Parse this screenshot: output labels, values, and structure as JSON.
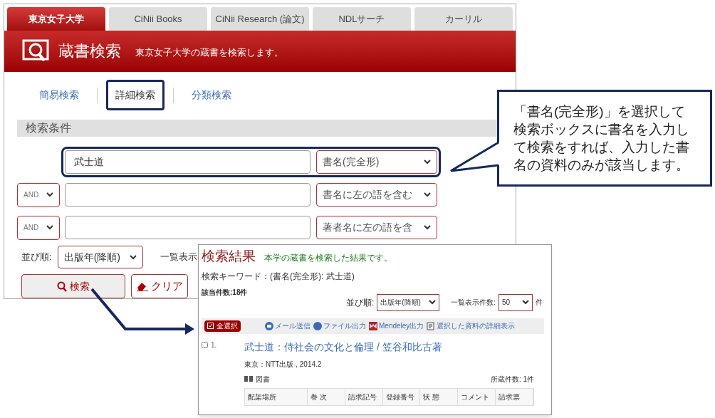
{
  "tabs": [
    {
      "label": "東京女子大学",
      "selected": true
    },
    {
      "label": "CiNii Books",
      "selected": false
    },
    {
      "label": "CiNii Research (論文)",
      "selected": false
    },
    {
      "label": "NDLサーチ",
      "selected": false
    },
    {
      "label": "カーリル",
      "selected": false
    }
  ],
  "header": {
    "title": "蔵書検索",
    "subtitle": "東京女子大学の蔵書を検索します。"
  },
  "search_modes": [
    {
      "label": "簡易検索",
      "selected": false
    },
    {
      "label": "詳細検索",
      "selected": true
    },
    {
      "label": "分類検索",
      "selected": false
    }
  ],
  "conditions": {
    "heading": "検索条件",
    "rows": [
      {
        "value": "武士道",
        "field": "書名(完全形)",
        "highlighted": true
      },
      {
        "operator": "AND",
        "field": "書名に左の語を含む",
        "highlighted": false
      },
      {
        "operator": "AND",
        "field": "著者名に左の語を含",
        "highlighted": false
      }
    ],
    "sort_label": "並び順:",
    "sort_value": "出版年(降順)",
    "per_page_label": "一覧表示"
  },
  "buttons": {
    "search": "検索",
    "clear": "クリア"
  },
  "results": {
    "title": "検索結果",
    "note": "本学の蔵書を検索した結果です。",
    "keyword": "検索キーワード：(書名(完全形): 武士道)",
    "count": "該当件数:18件",
    "sort_label": "並び順:",
    "sort_value": "出版年(降順)",
    "per_page_label": "一覧表示件数:",
    "per_page_value": "50",
    "per_page_unit": "件",
    "select_all": "全選択",
    "actions": [
      "メール送信",
      "ファイル出力",
      "Mendeley出力",
      "選択した資料の詳細表示"
    ],
    "items": [
      {
        "number": "1.",
        "checked": false,
        "title": "武士道：侍社会の文化と倫理 / 笠谷和比古著",
        "publisher": "東京：NTT出版 , 2014.2",
        "type": "図書",
        "holdings": "所蔵件数: 1件",
        "columns": [
          "配架場所",
          "巻 次",
          "請求記号",
          "登録番号",
          "状 態",
          "コメント",
          "請求票"
        ]
      }
    ]
  },
  "callout": "「書名(完全形)」を選択して検索ボックスに書名を入力して検索をすれば、入力した書名の資料のみが該当します。"
}
